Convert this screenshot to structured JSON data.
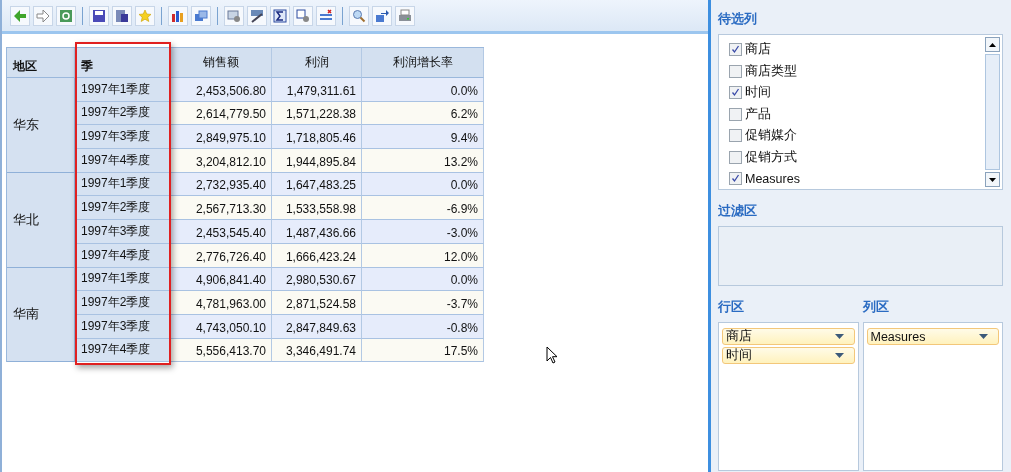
{
  "table": {
    "columns": [
      {
        "label": "地区",
        "kind": "dimension",
        "highlighted": false
      },
      {
        "label": "季",
        "kind": "dimension",
        "highlighted": true
      },
      {
        "label": "销售额",
        "kind": "measure",
        "highlighted": false
      },
      {
        "label": "利润",
        "kind": "measure",
        "highlighted": false
      },
      {
        "label": "利润增长率",
        "kind": "measure",
        "highlighted": false
      }
    ],
    "groups": [
      {
        "region": "华东",
        "rows": [
          [
            "1997年1季度",
            "2,453,506.80",
            "1,479,311.61",
            "0.0%"
          ],
          [
            "1997年2季度",
            "2,614,779.50",
            "1,571,228.38",
            "6.2%"
          ],
          [
            "1997年3季度",
            "2,849,975.10",
            "1,718,805.46",
            "9.4%"
          ],
          [
            "1997年4季度",
            "3,204,812.10",
            "1,944,895.84",
            "13.2%"
          ]
        ]
      },
      {
        "region": "华北",
        "rows": [
          [
            "1997年1季度",
            "2,732,935.40",
            "1,647,483.25",
            "0.0%"
          ],
          [
            "1997年2季度",
            "2,567,713.30",
            "1,533,558.98",
            "-6.9%"
          ],
          [
            "1997年3季度",
            "2,453,545.40",
            "1,487,436.66",
            "-3.0%"
          ],
          [
            "1997年4季度",
            "2,776,726.40",
            "1,666,423.24",
            "12.0%"
          ]
        ]
      },
      {
        "region": "华南",
        "rows": [
          [
            "1997年1季度",
            "4,906,841.40",
            "2,980,530.67",
            "0.0%"
          ],
          [
            "1997年2季度",
            "4,781,963.00",
            "2,871,524.58",
            "-3.7%"
          ],
          [
            "1997年3季度",
            "4,743,050.10",
            "2,847,849.63",
            "-0.8%"
          ],
          [
            "1997年4季度",
            "5,556,413.70",
            "3,346,491.74",
            "17.5%"
          ]
        ]
      }
    ]
  },
  "available_fields": {
    "title": "待选列",
    "fields": [
      {
        "label": "商店",
        "checked": true
      },
      {
        "label": "商店类型",
        "checked": false
      },
      {
        "label": "时间",
        "checked": true
      },
      {
        "label": "产品",
        "checked": false
      },
      {
        "label": "促销媒介",
        "checked": false
      },
      {
        "label": "促销方式",
        "checked": false
      },
      {
        "label": "Measures",
        "checked": true
      }
    ]
  },
  "filter_area": {
    "title": "过滤区"
  },
  "row_area": {
    "title": "行区",
    "items": [
      "商店",
      "时间"
    ]
  },
  "column_area": {
    "title": "列区",
    "items": [
      "Measures"
    ]
  }
}
